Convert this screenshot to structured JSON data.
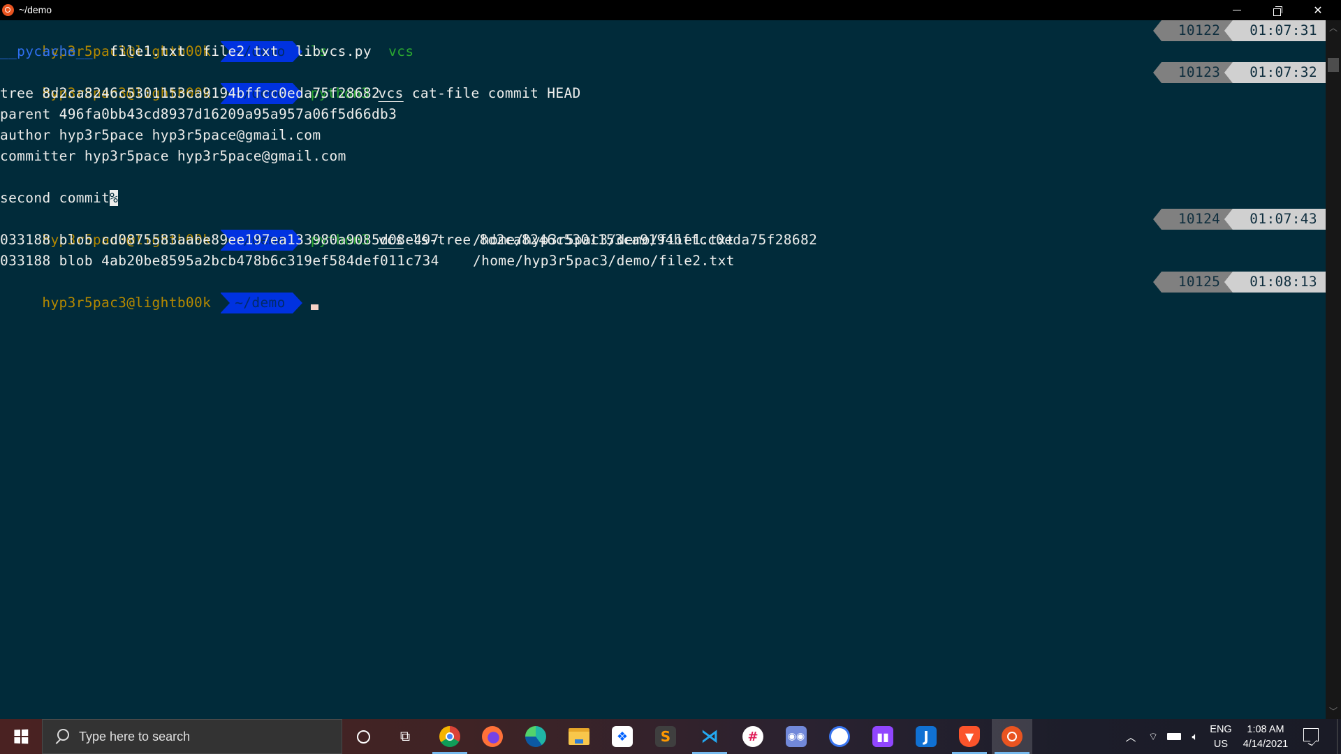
{
  "window": {
    "title": "~/demo",
    "icon": "ubuntu-icon",
    "controls": {
      "minimize": "minimize",
      "maximize": "restore",
      "close": "close"
    }
  },
  "terminal": {
    "prompt": {
      "user_host": "hyp3r5pac3@lightb00k",
      "dir": "~/demo"
    },
    "blocks": [
      {
        "command": {
          "first": "ls",
          "rest": ""
        },
        "history_number": "10122",
        "time": "01:07:31",
        "output": [
          {
            "segments": [
              {
                "text": "__pycache__",
                "kind": "dir"
              },
              {
                "text": "  file1.txt  file2.txt  libvcs.py  ",
                "kind": "plain"
              },
              {
                "text": "vcs",
                "kind": "exec"
              }
            ]
          }
        ]
      },
      {
        "command": {
          "first": "python3",
          "arg": "vcs",
          "rest": " cat-file commit HEAD"
        },
        "history_number": "10123",
        "time": "01:07:32",
        "output": [
          "tree 8d2ca8246c5301153ca9194bffcc0eda75f28682",
          "parent 496fa0bb43cd8937d16209a95a957a06f5d66db3",
          "author hyp3r5pace hyp3r5pace@gmail.com",
          "committer hyp3r5pace hyp3r5pace@gmail.com",
          "",
          "second commit"
        ],
        "no_newline_marker": "%"
      },
      {
        "command": {
          "first": "python3",
          "arg": "vcs",
          "rest": " ls-tree 8d2ca8246c5301153ca9194bffcc0eda75f28682"
        },
        "history_number": "10124",
        "time": "01:07:43",
        "output": [
          "033188 blob cd0875583aabe89ee197ea133980a9085d08e497    /home/hyp3r5pac3/demo/file1.txt",
          "033188 blob 4ab20be8595a2bcb478b6c319ef584def011c734    /home/hyp3r5pac3/demo/file2.txt"
        ]
      },
      {
        "command": {
          "first": "",
          "rest": ""
        },
        "history_number": "10125",
        "time": "01:08:13",
        "output": []
      }
    ],
    "colors": {
      "background": "#012b3a",
      "user_host": "#b58900",
      "dir_segment": "#0032e0",
      "command": "#2aa830",
      "directory_listing": "#2e6ff0",
      "history_segment": "#808080",
      "time_segment": "#d0d0d0"
    }
  },
  "taskbar": {
    "search_placeholder": "Type here to search",
    "apps": [
      {
        "name": "chrome",
        "active": false,
        "running": true
      },
      {
        "name": "firefox",
        "active": false,
        "running": false
      },
      {
        "name": "edge",
        "active": false,
        "running": false
      },
      {
        "name": "file-explorer",
        "active": false,
        "running": false
      },
      {
        "name": "dropbox",
        "active": false,
        "running": false
      },
      {
        "name": "sublime-text",
        "active": false,
        "running": false
      },
      {
        "name": "vscode",
        "active": false,
        "running": true
      },
      {
        "name": "slack",
        "active": false,
        "running": false
      },
      {
        "name": "discord",
        "active": false,
        "running": false
      },
      {
        "name": "signal",
        "active": false,
        "running": false
      },
      {
        "name": "twitch",
        "active": false,
        "running": false
      },
      {
        "name": "joplin",
        "active": false,
        "running": false
      },
      {
        "name": "brave",
        "active": false,
        "running": true
      },
      {
        "name": "ubuntu",
        "active": true,
        "running": true
      }
    ],
    "tray": {
      "language_top": "ENG",
      "language_bottom": "US",
      "time": "1:08 AM",
      "date": "4/14/2021",
      "show_hidden": "^"
    }
  }
}
